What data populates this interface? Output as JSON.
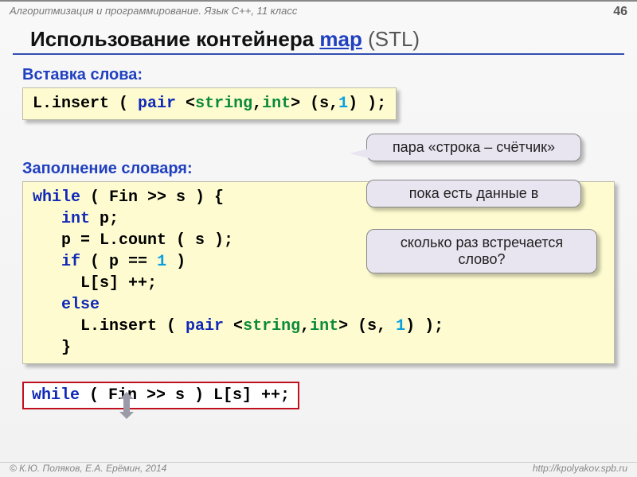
{
  "header": {
    "course": "Алгоритмизация и программирование. Язык C++, 11 класс",
    "page": "46"
  },
  "title": {
    "prefix": "Использование контейнера ",
    "link": "map",
    "suffix": " (STL)"
  },
  "section1": {
    "label": "Вставка слова:",
    "code": {
      "t1": "L.insert ( ",
      "kw_pair": "pair",
      "t2": " <",
      "ty_string": "string",
      "t3": ",",
      "ty_int": "int",
      "t4": "> (s,",
      "num_1": "1",
      "t5": ") );"
    }
  },
  "section2": {
    "label": "Заполнение словаря:",
    "code": {
      "l1a": "while",
      "l1b": " ( Fin >> s ) {",
      "l2a": "   ",
      "l2b": "int",
      "l2c": " p;",
      "l3": "   p = L.count ( s );",
      "l4a": "   ",
      "l4b": "if",
      "l4c": " ( p",
      "l4d": " == ",
      "l4e": "1",
      "l4f": " )",
      "l5": "     L[s] ++;",
      "l6a": "   ",
      "l6b": "else",
      "l7a": "     L.insert ( ",
      "l7b": "pair",
      "l7c": " <",
      "l7d": "string",
      "l7e": ",",
      "l7f": "int",
      "l7g": "> (s, ",
      "l7h": "1",
      "l7i": ") );",
      "l8": "   }"
    }
  },
  "callouts": {
    "c1": "пара «строка – счётчик»",
    "c2": "пока есть данные в",
    "c3": "сколько раз встречается слово?"
  },
  "short": {
    "kw": "while",
    "rest": " ( Fin >> s ) L[s] ++;"
  },
  "footer": {
    "left": "© К.Ю. Поляков, Е.А. Ерёмин, 2014",
    "right": "http://kpolyakov.spb.ru"
  }
}
